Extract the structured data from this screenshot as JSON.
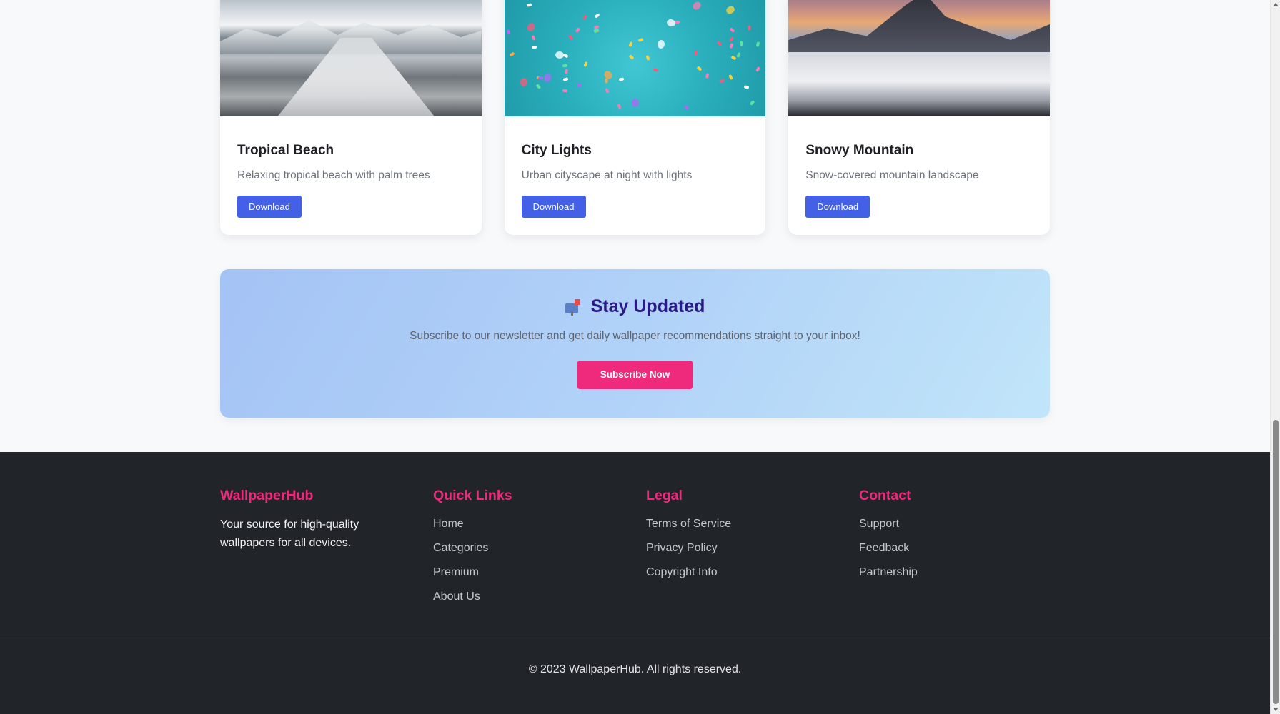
{
  "cards": [
    {
      "title": "Tropical Beach",
      "description": "Relaxing tropical beach with palm trees",
      "button": "Download"
    },
    {
      "title": "City Lights",
      "description": "Urban cityscape at night with lights",
      "button": "Download"
    },
    {
      "title": "Snowy Mountain",
      "description": "Snow-covered mountain landscape",
      "button": "Download"
    }
  ],
  "newsletter": {
    "icon": "mailbox-icon",
    "title": "Stay Updated",
    "text": "Subscribe to our newsletter and get daily wallpaper recommendations straight to your inbox!",
    "button": "Subscribe Now"
  },
  "footer": {
    "brand": {
      "title": "WallpaperHub",
      "text": "Your source for high-quality wallpapers for all devices."
    },
    "quick_links": {
      "title": "Quick Links",
      "items": [
        "Home",
        "Categories",
        "Premium",
        "About Us"
      ]
    },
    "legal": {
      "title": "Legal",
      "items": [
        "Terms of Service",
        "Privacy Policy",
        "Copyright Info"
      ]
    },
    "contact": {
      "title": "Contact",
      "items": [
        "Support",
        "Feedback",
        "Partnership"
      ]
    },
    "copyright": "© 2023 WallpaperHub. All rights reserved."
  },
  "colors": {
    "accent_blue": "#4360e6",
    "accent_pink": "#ef2a7c",
    "footer_bg": "#212429",
    "newsletter_title": "#2a1a88"
  }
}
